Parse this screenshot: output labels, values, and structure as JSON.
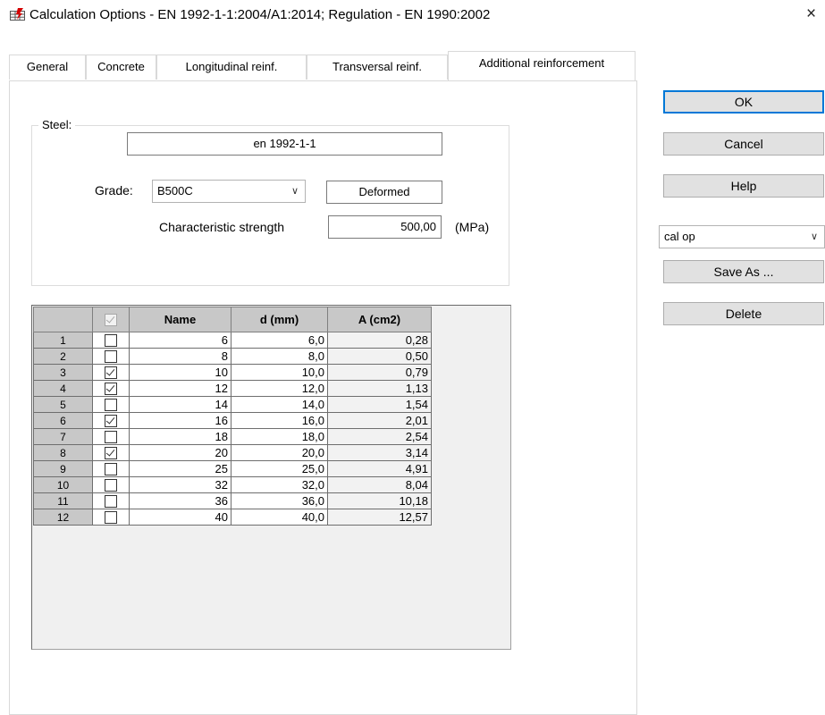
{
  "window": {
    "title": "Calculation Options - EN 1992-1-1:2004/A1:2014;  Regulation - EN 1990:2002",
    "close_glyph": "×"
  },
  "tabs": [
    {
      "label": "General"
    },
    {
      "label": "Concrete"
    },
    {
      "label": "Longitudinal reinf."
    },
    {
      "label": "Transversal reinf."
    },
    {
      "label": "Additional reinforcement",
      "active": true
    }
  ],
  "steel": {
    "group_label": "Steel:",
    "standard": "en 1992-1-1",
    "grade_label": "Grade:",
    "grade_value": "B500C",
    "bar_type": "Deformed",
    "strength_label": "Characteristic strength",
    "strength_value": "500,00",
    "strength_unit": "(MPa)"
  },
  "grid": {
    "headers": {
      "name": "Name",
      "d": "d (mm)",
      "a": "A (cm2)"
    },
    "rows": [
      {
        "n": "1",
        "checked": false,
        "name": "6",
        "d": "6,0",
        "a": "0,28"
      },
      {
        "n": "2",
        "checked": false,
        "name": "8",
        "d": "8,0",
        "a": "0,50"
      },
      {
        "n": "3",
        "checked": true,
        "name": "10",
        "d": "10,0",
        "a": "0,79"
      },
      {
        "n": "4",
        "checked": true,
        "name": "12",
        "d": "12,0",
        "a": "1,13"
      },
      {
        "n": "5",
        "checked": false,
        "name": "14",
        "d": "14,0",
        "a": "1,54"
      },
      {
        "n": "6",
        "checked": true,
        "name": "16",
        "d": "16,0",
        "a": "2,01"
      },
      {
        "n": "7",
        "checked": false,
        "name": "18",
        "d": "18,0",
        "a": "2,54"
      },
      {
        "n": "8",
        "checked": true,
        "name": "20",
        "d": "20,0",
        "a": "3,14"
      },
      {
        "n": "9",
        "checked": false,
        "name": "25",
        "d": "25,0",
        "a": "4,91"
      },
      {
        "n": "10",
        "checked": false,
        "name": "32",
        "d": "32,0",
        "a": "8,04"
      },
      {
        "n": "11",
        "checked": false,
        "name": "36",
        "d": "36,0",
        "a": "10,18"
      },
      {
        "n": "12",
        "checked": false,
        "name": "40",
        "d": "40,0",
        "a": "12,57"
      }
    ]
  },
  "buttons": {
    "ok": "OK",
    "cancel": "Cancel",
    "help": "Help",
    "save_as": "Save As ...",
    "delete": "Delete"
  },
  "preset": {
    "value": "cal op"
  },
  "colors": {
    "accent": "#0078d7",
    "header_bg": "#c8c8c8",
    "button_bg": "#e1e1e1"
  },
  "icons": {
    "app": "calculation-options-icon",
    "close": "close-icon",
    "dropdown": "chevron-down-icon",
    "check": "checkmark-icon"
  }
}
